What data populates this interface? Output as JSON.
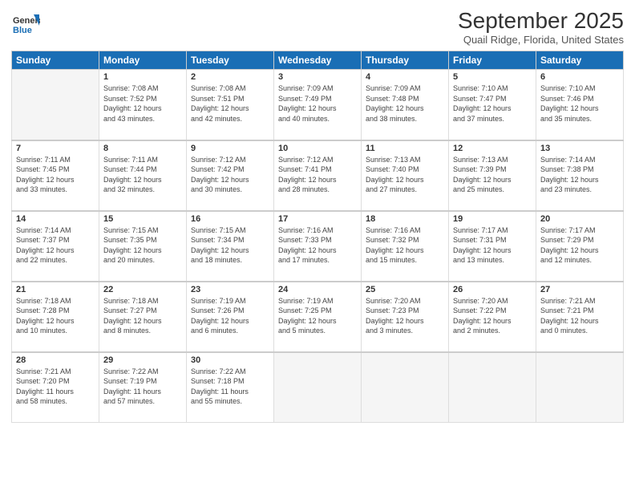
{
  "header": {
    "logo_line1": "General",
    "logo_line2": "Blue",
    "month": "September 2025",
    "location": "Quail Ridge, Florida, United States"
  },
  "weekdays": [
    "Sunday",
    "Monday",
    "Tuesday",
    "Wednesday",
    "Thursday",
    "Friday",
    "Saturday"
  ],
  "weeks": [
    [
      {
        "day": "",
        "info": ""
      },
      {
        "day": "1",
        "info": "Sunrise: 7:08 AM\nSunset: 7:52 PM\nDaylight: 12 hours\nand 43 minutes."
      },
      {
        "day": "2",
        "info": "Sunrise: 7:08 AM\nSunset: 7:51 PM\nDaylight: 12 hours\nand 42 minutes."
      },
      {
        "day": "3",
        "info": "Sunrise: 7:09 AM\nSunset: 7:49 PM\nDaylight: 12 hours\nand 40 minutes."
      },
      {
        "day": "4",
        "info": "Sunrise: 7:09 AM\nSunset: 7:48 PM\nDaylight: 12 hours\nand 38 minutes."
      },
      {
        "day": "5",
        "info": "Sunrise: 7:10 AM\nSunset: 7:47 PM\nDaylight: 12 hours\nand 37 minutes."
      },
      {
        "day": "6",
        "info": "Sunrise: 7:10 AM\nSunset: 7:46 PM\nDaylight: 12 hours\nand 35 minutes."
      }
    ],
    [
      {
        "day": "7",
        "info": "Sunrise: 7:11 AM\nSunset: 7:45 PM\nDaylight: 12 hours\nand 33 minutes."
      },
      {
        "day": "8",
        "info": "Sunrise: 7:11 AM\nSunset: 7:44 PM\nDaylight: 12 hours\nand 32 minutes."
      },
      {
        "day": "9",
        "info": "Sunrise: 7:12 AM\nSunset: 7:42 PM\nDaylight: 12 hours\nand 30 minutes."
      },
      {
        "day": "10",
        "info": "Sunrise: 7:12 AM\nSunset: 7:41 PM\nDaylight: 12 hours\nand 28 minutes."
      },
      {
        "day": "11",
        "info": "Sunrise: 7:13 AM\nSunset: 7:40 PM\nDaylight: 12 hours\nand 27 minutes."
      },
      {
        "day": "12",
        "info": "Sunrise: 7:13 AM\nSunset: 7:39 PM\nDaylight: 12 hours\nand 25 minutes."
      },
      {
        "day": "13",
        "info": "Sunrise: 7:14 AM\nSunset: 7:38 PM\nDaylight: 12 hours\nand 23 minutes."
      }
    ],
    [
      {
        "day": "14",
        "info": "Sunrise: 7:14 AM\nSunset: 7:37 PM\nDaylight: 12 hours\nand 22 minutes."
      },
      {
        "day": "15",
        "info": "Sunrise: 7:15 AM\nSunset: 7:35 PM\nDaylight: 12 hours\nand 20 minutes."
      },
      {
        "day": "16",
        "info": "Sunrise: 7:15 AM\nSunset: 7:34 PM\nDaylight: 12 hours\nand 18 minutes."
      },
      {
        "day": "17",
        "info": "Sunrise: 7:16 AM\nSunset: 7:33 PM\nDaylight: 12 hours\nand 17 minutes."
      },
      {
        "day": "18",
        "info": "Sunrise: 7:16 AM\nSunset: 7:32 PM\nDaylight: 12 hours\nand 15 minutes."
      },
      {
        "day": "19",
        "info": "Sunrise: 7:17 AM\nSunset: 7:31 PM\nDaylight: 12 hours\nand 13 minutes."
      },
      {
        "day": "20",
        "info": "Sunrise: 7:17 AM\nSunset: 7:29 PM\nDaylight: 12 hours\nand 12 minutes."
      }
    ],
    [
      {
        "day": "21",
        "info": "Sunrise: 7:18 AM\nSunset: 7:28 PM\nDaylight: 12 hours\nand 10 minutes."
      },
      {
        "day": "22",
        "info": "Sunrise: 7:18 AM\nSunset: 7:27 PM\nDaylight: 12 hours\nand 8 minutes."
      },
      {
        "day": "23",
        "info": "Sunrise: 7:19 AM\nSunset: 7:26 PM\nDaylight: 12 hours\nand 6 minutes."
      },
      {
        "day": "24",
        "info": "Sunrise: 7:19 AM\nSunset: 7:25 PM\nDaylight: 12 hours\nand 5 minutes."
      },
      {
        "day": "25",
        "info": "Sunrise: 7:20 AM\nSunset: 7:23 PM\nDaylight: 12 hours\nand 3 minutes."
      },
      {
        "day": "26",
        "info": "Sunrise: 7:20 AM\nSunset: 7:22 PM\nDaylight: 12 hours\nand 2 minutes."
      },
      {
        "day": "27",
        "info": "Sunrise: 7:21 AM\nSunset: 7:21 PM\nDaylight: 12 hours\nand 0 minutes."
      }
    ],
    [
      {
        "day": "28",
        "info": "Sunrise: 7:21 AM\nSunset: 7:20 PM\nDaylight: 11 hours\nand 58 minutes."
      },
      {
        "day": "29",
        "info": "Sunrise: 7:22 AM\nSunset: 7:19 PM\nDaylight: 11 hours\nand 57 minutes."
      },
      {
        "day": "30",
        "info": "Sunrise: 7:22 AM\nSunset: 7:18 PM\nDaylight: 11 hours\nand 55 minutes."
      },
      {
        "day": "",
        "info": ""
      },
      {
        "day": "",
        "info": ""
      },
      {
        "day": "",
        "info": ""
      },
      {
        "day": "",
        "info": ""
      }
    ]
  ]
}
